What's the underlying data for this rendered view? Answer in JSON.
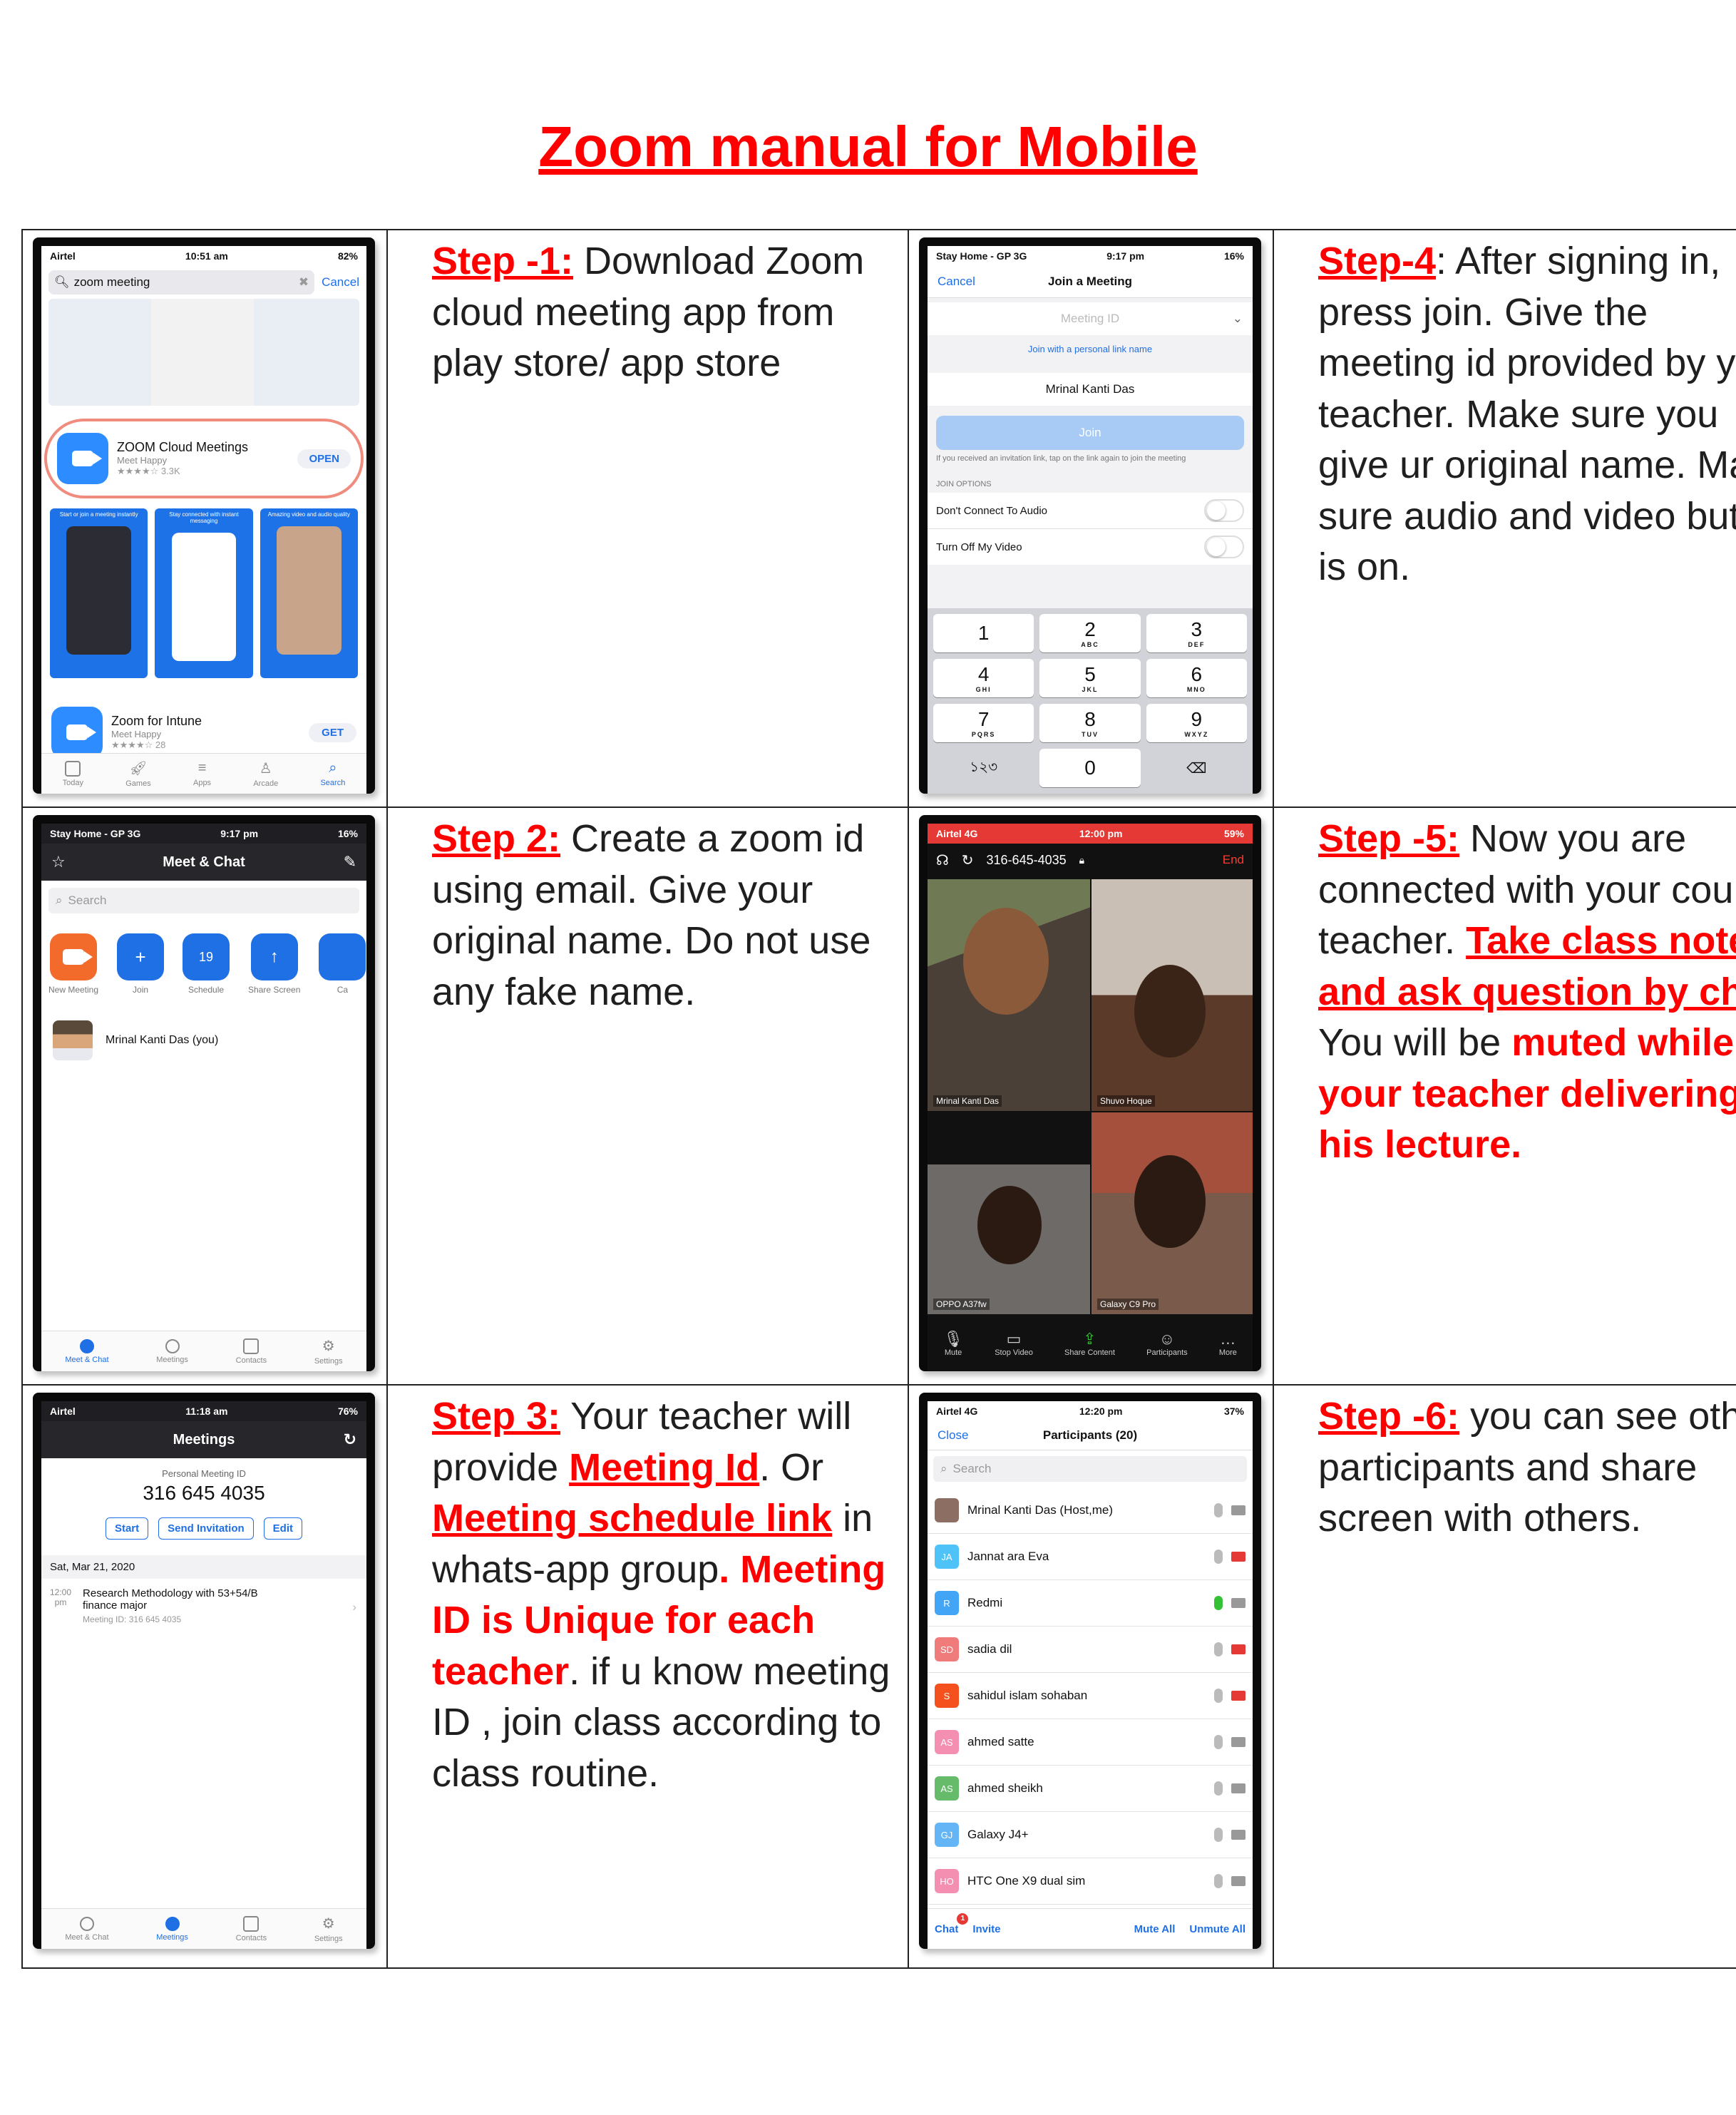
{
  "title": "Zoom manual for Mobile",
  "steps": {
    "s1": {
      "label": "Step -1:",
      "text": " Download Zoom cloud meeting app from play store/ app store"
    },
    "s2": {
      "label": "Step 2:",
      "text": " Create a zoom id using email. Give your original name. Do not use any fake name."
    },
    "s3": {
      "label": "Step 3:",
      "t1": " Your teacher will provide ",
      "link1": "Meeting Id",
      "t2": ". Or ",
      "link2": "Meeting schedule link",
      "t3": " in whats-app group",
      "t4": ". ",
      "red1": "Meeting ID is Unique for each teacher",
      "t5": ". if u know meeting ID , join class according to class routine."
    },
    "s4": {
      "label": "Step-4",
      "text": ": After signing in, press join. Give the meeting id provided by your teacher. Make sure you give ur original name. Make sure audio and video button is on."
    },
    "s5": {
      "label": "Step -5:",
      "t1": " Now you are connected with your course teacher. ",
      "link1": "Take class note and ask question by chat",
      "t2": ". You will be ",
      "red1": "muted while your teacher delivering his lecture."
    },
    "s6": {
      "label": "Step -6:",
      "text": " you can see other participants and share screen with others."
    }
  },
  "phone1": {
    "carrier": "Airtel",
    "time": "10:51 am",
    "battery": "82%",
    "search": "zoom meeting",
    "cancel": "Cancel",
    "app1": {
      "name": "ZOOM Cloud Meetings",
      "dev": "Meet Happy",
      "rating": "★★★★☆",
      "count": "3.3K",
      "action": "OPEN"
    },
    "shots": [
      "Start or join a meeting instantly",
      "Stay connected with instant messaging",
      "Amazing video and audio quality"
    ],
    "app2": {
      "name": "Zoom for Intune",
      "dev": "Meet Happy",
      "rating": "★★★★☆",
      "count": "28",
      "action": "GET"
    },
    "tabs": [
      "Today",
      "Games",
      "Apps",
      "Arcade",
      "Search"
    ]
  },
  "phone2": {
    "carrier": "Stay Home - GP  3G",
    "time": "9:17 pm",
    "battery": "16%",
    "title": "Meet & Chat",
    "search": "Search",
    "actions": [
      "New Meeting",
      "Join",
      "Schedule",
      "Share Screen",
      "Ca"
    ],
    "schedule_day": "19",
    "contact": "Mrinal Kanti Das (you)",
    "tabs": [
      "Meet & Chat",
      "Meetings",
      "Contacts",
      "Settings"
    ]
  },
  "phone3": {
    "carrier": "Airtel",
    "time": "11:18 am",
    "battery": "76%",
    "title": "Meetings",
    "pmi_label": "Personal Meeting ID",
    "pmi": "316 645 4035",
    "buttons": [
      "Start",
      "Send Invitation",
      "Edit"
    ],
    "date": "Sat, Mar 21, 2020",
    "m_time": "12:00",
    "m_ampm": "pm",
    "m_title": "Research Methodology with 53+54/B finance major",
    "m_id": "Meeting ID: 316 645 4035",
    "tabs": [
      "Meet & Chat",
      "Meetings",
      "Contacts",
      "Settings"
    ]
  },
  "phone4": {
    "carrier": "Stay Home - GP  3G",
    "time": "9:17 pm",
    "battery": "16%",
    "cancel": "Cancel",
    "title": "Join a Meeting",
    "id_ph": "Meeting ID",
    "link": "Join with a personal link name",
    "name": "Mrinal Kanti Das",
    "join": "Join",
    "hint": "If you received an invitation link, tap on the link again to join the meeting",
    "opts_hdr": "JOIN OPTIONS",
    "opt1": "Don't Connect To Audio",
    "opt2": "Turn Off My Video",
    "keys": [
      [
        "1",
        ""
      ],
      [
        "2",
        "ABC"
      ],
      [
        "3",
        "DEF"
      ],
      [
        "4",
        "GHI"
      ],
      [
        "5",
        "JKL"
      ],
      [
        "6",
        "MNO"
      ],
      [
        "7",
        "PQRS"
      ],
      [
        "8",
        "TUV"
      ],
      [
        "9",
        "WXYZ"
      ],
      [
        "১২৩",
        ""
      ],
      [
        "0",
        ""
      ],
      [
        "⌫",
        ""
      ]
    ]
  },
  "phone5": {
    "carrier": "Airtel  4G",
    "time": "12:00 pm",
    "battery": "59%",
    "mid": "316-645-4035",
    "end": "End",
    "tiles": [
      "Mrinal Kanti Das",
      "Shuvo Hoque",
      "OPPO A37fw",
      "Galaxy C9 Pro"
    ],
    "controls": [
      "Mute",
      "Stop Video",
      "Share Content",
      "Participants",
      "More"
    ]
  },
  "phone6": {
    "carrier": "Airtel  4G",
    "time": "12:20 pm",
    "battery": "37%",
    "close": "Close",
    "title": "Participants (20)",
    "search": "Search",
    "people": [
      {
        "ini": "",
        "name": "Mrinal Kanti Das (Host,me)",
        "color": "#8d6e63",
        "mic": "off",
        "vid": "on"
      },
      {
        "ini": "JA",
        "name": "Jannat ara Eva",
        "color": "#4fc3f7",
        "mic": "off",
        "vid": "off"
      },
      {
        "ini": "R",
        "name": "Redmi",
        "color": "#42a5f5",
        "mic": "on",
        "vid": "on"
      },
      {
        "ini": "SD",
        "name": "sadia dil",
        "color": "#ef7b7b",
        "mic": "off",
        "vid": "off"
      },
      {
        "ini": "S",
        "name": "sahidul islam sohaban",
        "color": "#f4511e",
        "mic": "off",
        "vid": "off"
      },
      {
        "ini": "AS",
        "name": "ahmed satte",
        "color": "#f48fb1",
        "mic": "off",
        "vid": "on"
      },
      {
        "ini": "AS",
        "name": "ahmed sheikh",
        "color": "#66bb6a",
        "mic": "off",
        "vid": "on"
      },
      {
        "ini": "GJ",
        "name": "Galaxy J4+",
        "color": "#64b5f6",
        "mic": "off",
        "vid": "on"
      },
      {
        "ini": "HO",
        "name": "HTC One X9 dual sim",
        "color": "#f48fb1",
        "mic": "off",
        "vid": "on"
      }
    ],
    "chat_badge": "1",
    "bottom": [
      "Chat",
      "Invite",
      "Mute All",
      "Unmute All"
    ]
  }
}
